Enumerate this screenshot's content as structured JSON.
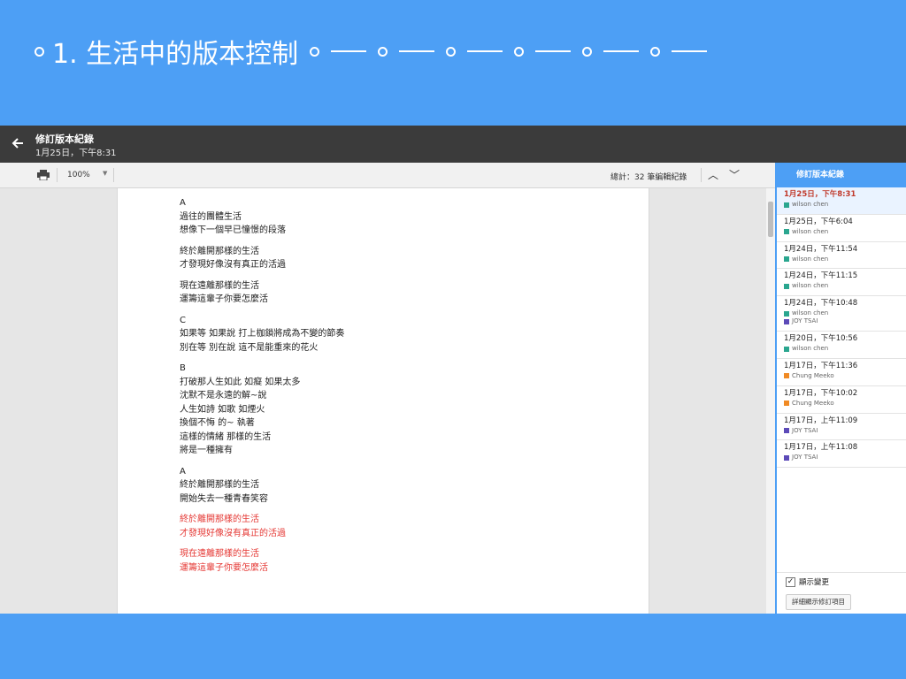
{
  "slide": {
    "title": "1. 生活中的版本控制"
  },
  "topbar": {
    "title": "修訂版本紀錄",
    "subtitle": "1月25日，下午8:31",
    "back_icon": "arrow-left-icon"
  },
  "toolbar": {
    "print_icon": "print-icon",
    "zoom": "100%",
    "total": "總計：32 筆編輯紀錄",
    "nav_up_icon": "chevron-up-icon",
    "nav_down_icon": "chevron-down-icon"
  },
  "document": {
    "lines": [
      {
        "text": "A",
        "color": "normal"
      },
      {
        "text": "過往的團體生活",
        "color": "normal"
      },
      {
        "text": "想像下一個早已憧憬的段落",
        "color": "normal"
      },
      {
        "text": "",
        "color": "gap"
      },
      {
        "text": "終於離開那樣的生活",
        "color": "normal"
      },
      {
        "text": "才發現好像沒有真正的活過",
        "color": "normal"
      },
      {
        "text": "",
        "color": "gap"
      },
      {
        "text": "現在遠離那樣的生活",
        "color": "normal"
      },
      {
        "text": "運籌這輩子你要怎麼活",
        "color": "normal"
      },
      {
        "text": "",
        "color": "gap"
      },
      {
        "text": "C",
        "color": "normal"
      },
      {
        "text": "如果等 如果說 打上枷鎖將成為不變的節奏",
        "color": "normal"
      },
      {
        "text": "別在等 別在說 這不是能重來的花火",
        "color": "normal"
      },
      {
        "text": "",
        "color": "gap"
      },
      {
        "text": "B",
        "color": "normal"
      },
      {
        "text": "打破那人生如此 如癡 如果太多",
        "color": "normal"
      },
      {
        "text": "沈默不是永遠的解~說",
        "color": "normal"
      },
      {
        "text": "人生如詩 如歌 如煙火",
        "color": "normal"
      },
      {
        "text": "換個不悔 的~ 執著",
        "color": "normal"
      },
      {
        "text": "這樣的情緒 那樣的生活",
        "color": "normal"
      },
      {
        "text": "將是一種擁有",
        "color": "normal"
      },
      {
        "text": "",
        "color": "gap"
      },
      {
        "text": "A",
        "color": "normal"
      },
      {
        "text": "終於離開那樣的生活",
        "color": "normal"
      },
      {
        "text": "開始失去一種青春笑容",
        "color": "normal"
      },
      {
        "text": "",
        "color": "gap"
      },
      {
        "text": "終於離開那樣的生活",
        "color": "red"
      },
      {
        "text": "才發現好像沒有真正的活過",
        "color": "red"
      },
      {
        "text": "",
        "color": "gap"
      },
      {
        "text": "現在遠離那樣的生活",
        "color": "red"
      },
      {
        "text": "運籌這輩子你要怎麼活",
        "color": "red"
      }
    ]
  },
  "revisions": {
    "header": "修訂版本紀錄",
    "items": [
      {
        "time": "1月25日，下午8:31",
        "selected": true,
        "editors": [
          {
            "name": "wilson chen",
            "color": "#2aa68f"
          }
        ]
      },
      {
        "time": "1月25日，下午6:04",
        "selected": false,
        "editors": [
          {
            "name": "wilson chen",
            "color": "#2aa68f"
          }
        ]
      },
      {
        "time": "1月24日，下午11:54",
        "selected": false,
        "editors": [
          {
            "name": "wilson chen",
            "color": "#2aa68f"
          }
        ]
      },
      {
        "time": "1月24日，下午11:15",
        "selected": false,
        "editors": [
          {
            "name": "wilson chen",
            "color": "#2aa68f"
          }
        ]
      },
      {
        "time": "1月24日，下午10:48",
        "selected": false,
        "editors": [
          {
            "name": "wilson chen",
            "color": "#2aa68f"
          },
          {
            "name": "JOY TSAI",
            "color": "#5c4ab8"
          }
        ]
      },
      {
        "time": "1月20日，下午10:56",
        "selected": false,
        "editors": [
          {
            "name": "wilson chen",
            "color": "#2aa68f"
          }
        ]
      },
      {
        "time": "1月17日，下午11:36",
        "selected": false,
        "editors": [
          {
            "name": "Chung Meeko",
            "color": "#f08a24"
          }
        ]
      },
      {
        "time": "1月17日，下午10:02",
        "selected": false,
        "editors": [
          {
            "name": "Chung Meeko",
            "color": "#f08a24"
          }
        ]
      },
      {
        "time": "1月17日，上午11:09",
        "selected": false,
        "editors": [
          {
            "name": "JOY TSAI",
            "color": "#5c4ab8"
          }
        ]
      },
      {
        "time": "1月17日，上午11:08",
        "selected": false,
        "editors": [
          {
            "name": "JOY TSAI",
            "color": "#5c4ab8"
          }
        ]
      }
    ],
    "show_changes_label": "顯示變更",
    "show_changes_checked": true,
    "detail_button": "詳細顯示修訂項目"
  }
}
